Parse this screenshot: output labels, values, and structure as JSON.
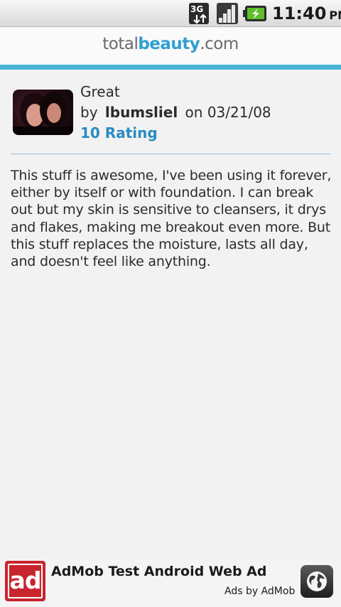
{
  "status_bar": {
    "network_icon": "3g-data-icon",
    "signal_icon": "signal-strength-icon",
    "battery_icon": "battery-charging-icon",
    "time": "11:40",
    "ampm": "PM"
  },
  "header": {
    "logo_total": "total",
    "logo_beauty": "beauty",
    "logo_dotcom": ".com",
    "accent_color": "#49b3d4"
  },
  "review": {
    "title": "Great",
    "by_label": "by",
    "author": "lbumsliel",
    "on_label": "on",
    "date": "03/21/08",
    "rating": "10 Rating",
    "body": "This stuff is awesome, I've been using it forever, either by itself or with foundation. I can break out but my skin is sensitive to cleansers, it drys and flakes, making me breakout even more. But this stuff replaces the moisture, lasts all day, and doesn't feel like anything."
  },
  "ad": {
    "logo_text": "ad",
    "title": "AdMob Test Android Web Ad",
    "subtitle": "Ads by AdMob",
    "icon": "globe-icon"
  }
}
